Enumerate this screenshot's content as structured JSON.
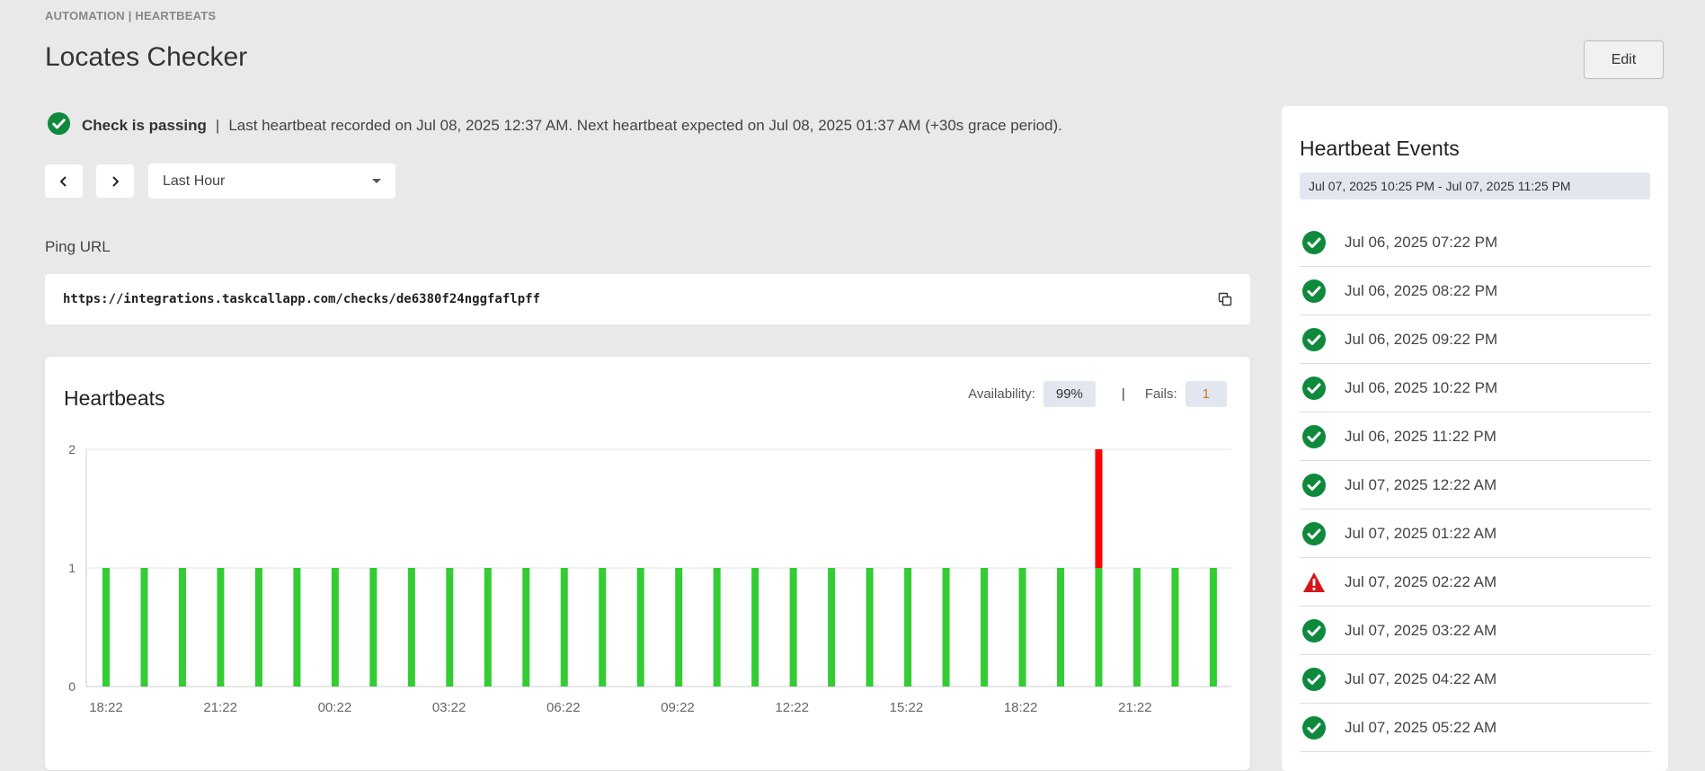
{
  "breadcrumb": "AUTOMATION | HEARTBEATS",
  "title": "Locates Checker",
  "edit_label": "Edit",
  "status": {
    "label": "Check is passing",
    "separator": "|",
    "message": "Last heartbeat recorded on Jul 08, 2025 12:37 AM. Next heartbeat expected on Jul 08, 2025 01:37 AM (+30s grace period)."
  },
  "range_select": {
    "value": "Last Hour"
  },
  "ping": {
    "label": "Ping URL",
    "url": "https://integrations.taskcallapp.com/checks/de6380f24nggfaflpff"
  },
  "heartbeats": {
    "title": "Heartbeats",
    "availability_label": "Availability:",
    "availability_value": "99%",
    "stat_separator": "|",
    "fails_label": "Fails:",
    "fails_value": "1"
  },
  "colors": {
    "pass": "#33cc33",
    "fail": "#ff0000",
    "pass_icon": "#0f8a3d",
    "fail_icon": "#d7151b"
  },
  "chart_data": {
    "type": "bar",
    "stacked": true,
    "ylim": [
      0,
      2
    ],
    "yticks": [
      0,
      1,
      2
    ],
    "xticks": [
      "18:22",
      "21:22",
      "00:22",
      "03:22",
      "06:22",
      "09:22",
      "12:22",
      "15:22",
      "18:22",
      "21:22"
    ],
    "series": [
      {
        "name": "",
        "color": "#33cc33",
        "values": [
          1,
          1,
          1,
          1,
          1,
          1,
          1,
          1,
          1,
          1,
          1,
          1,
          1,
          1,
          1,
          1,
          1,
          1,
          1,
          1,
          1,
          1,
          1,
          1,
          1,
          1,
          1,
          1,
          1,
          1
        ]
      },
      {
        "name": "",
        "color": "#ff0000",
        "values": [
          0,
          0,
          0,
          0,
          0,
          0,
          0,
          0,
          0,
          0,
          0,
          0,
          0,
          0,
          0,
          0,
          0,
          0,
          0,
          0,
          0,
          0,
          0,
          0,
          0,
          0,
          1,
          0,
          0,
          0
        ]
      }
    ],
    "grid": "horizontal",
    "legend": "none"
  },
  "events": {
    "title": "Heartbeat Events",
    "range": "Jul 07, 2025 10:25 PM - Jul 07, 2025 11:25 PM",
    "items": [
      {
        "time": "Jul 06, 2025 07:22 PM",
        "status": "pass",
        "icon": "check-circle-icon"
      },
      {
        "time": "Jul 06, 2025 08:22 PM",
        "status": "pass",
        "icon": "check-circle-icon"
      },
      {
        "time": "Jul 06, 2025 09:22 PM",
        "status": "pass",
        "icon": "check-circle-icon"
      },
      {
        "time": "Jul 06, 2025 10:22 PM",
        "status": "pass",
        "icon": "check-circle-icon"
      },
      {
        "time": "Jul 06, 2025 11:22 PM",
        "status": "pass",
        "icon": "check-circle-icon"
      },
      {
        "time": "Jul 07, 2025 12:22 AM",
        "status": "pass",
        "icon": "check-circle-icon"
      },
      {
        "time": "Jul 07, 2025 01:22 AM",
        "status": "pass",
        "icon": "check-circle-icon"
      },
      {
        "time": "Jul 07, 2025 02:22 AM",
        "status": "fail",
        "icon": "warning-triangle-icon"
      },
      {
        "time": "Jul 07, 2025 03:22 AM",
        "status": "pass",
        "icon": "check-circle-icon"
      },
      {
        "time": "Jul 07, 2025 04:22 AM",
        "status": "pass",
        "icon": "check-circle-icon"
      },
      {
        "time": "Jul 07, 2025 05:22 AM",
        "status": "pass",
        "icon": "check-circle-icon"
      }
    ]
  }
}
